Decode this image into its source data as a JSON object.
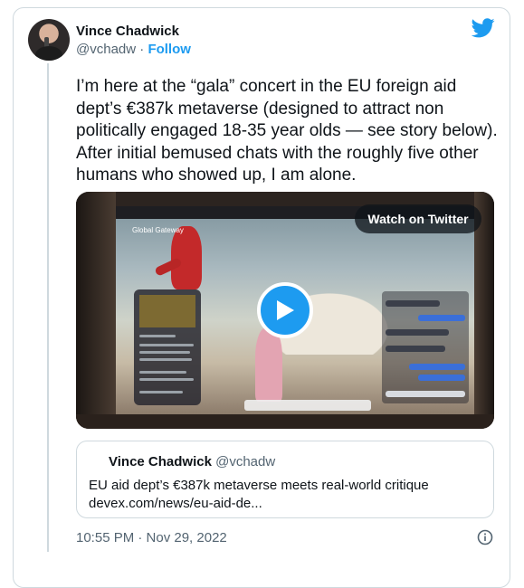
{
  "tweet": {
    "author_name": "Vince Chadwick",
    "handle": "@vchadw",
    "separator": " · ",
    "follow_label": "Follow",
    "text": "I’m here at the “gala” concert in the EU foreign aid dept’s €387k metaverse (designed to attract non politically engaged 18-35 year olds — see story below). After initial bemused chats with the roughly five other humans who showed up, I am alone.",
    "timestamp": "10:55 PM · Nov 29, 2022"
  },
  "media": {
    "watch_label": "Watch on Twitter",
    "logo_text": "Global Gateway"
  },
  "quote": {
    "author_name": "Vince Chadwick",
    "handle": "@vchadw",
    "title": "EU aid dept’s €387k metaverse meets real-world critique",
    "link": "devex.com/news/eu-aid-de..."
  },
  "colors": {
    "accent": "#1d9bf0",
    "text": "#0f1419",
    "muted": "#536471",
    "border": "#cfd9de"
  },
  "icons": {
    "brand": "twitter-bird-icon",
    "play": "play-icon",
    "info": "info-icon"
  }
}
